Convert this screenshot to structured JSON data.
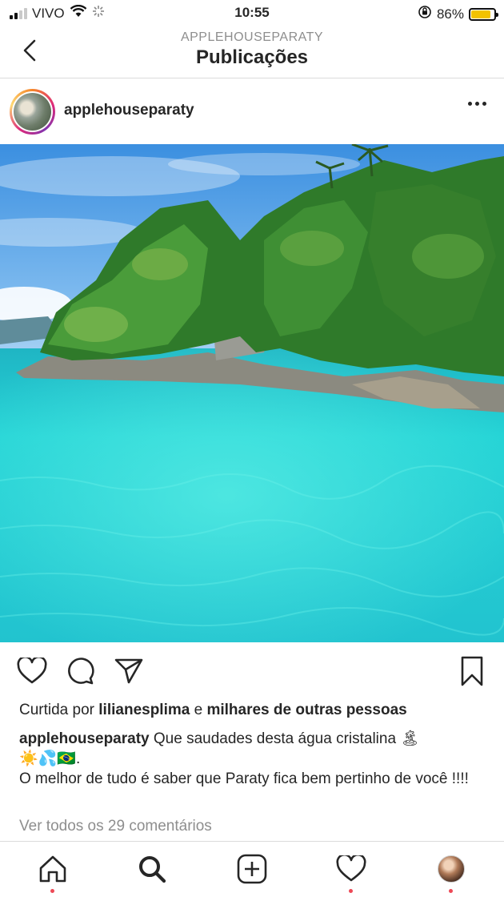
{
  "status_bar": {
    "carrier": "VIVO",
    "time": "10:55",
    "battery_percent": "86%",
    "battery_level": 0.86,
    "icons": [
      "signal-icon",
      "wifi-icon",
      "activity-icon",
      "orientation-lock-icon",
      "battery-icon"
    ]
  },
  "nav": {
    "subtitle": "APPLEHOUSEPARATY",
    "title": "Publicações",
    "back_icon": "chevron-left-icon"
  },
  "post": {
    "username": "applehouseparaty",
    "more_icon": "more-horizontal-icon",
    "image_description_icon": "photo",
    "actions": {
      "like_icon": "heart-icon",
      "comment_icon": "comment-icon",
      "share_icon": "send-icon",
      "save_icon": "bookmark-icon"
    },
    "likes": {
      "prefix": "Curtida por",
      "user": "lilianesplima",
      "connector": "e",
      "others": "milhares de outras pessoas"
    },
    "caption": {
      "user": "applehouseparaty",
      "text_line1": "Que saudades desta água cristalina 🏝",
      "text_line2": "☀️💦🇧🇷.",
      "text_line3": "O melhor de tudo é saber que Paraty fica bem pertinho de você !!!!"
    },
    "view_comments": "Ver todos os 29 comentários"
  },
  "tabbar": {
    "items": [
      "home-icon",
      "search-icon",
      "new-post-icon",
      "activity-heart-icon",
      "profile-avatar"
    ],
    "colors": {
      "notification_dot": "#ed4956"
    }
  },
  "colors": {
    "text": "#262626",
    "muted": "#8e8e8e",
    "divider": "#dbdbdb",
    "battery": "#f2c200"
  }
}
